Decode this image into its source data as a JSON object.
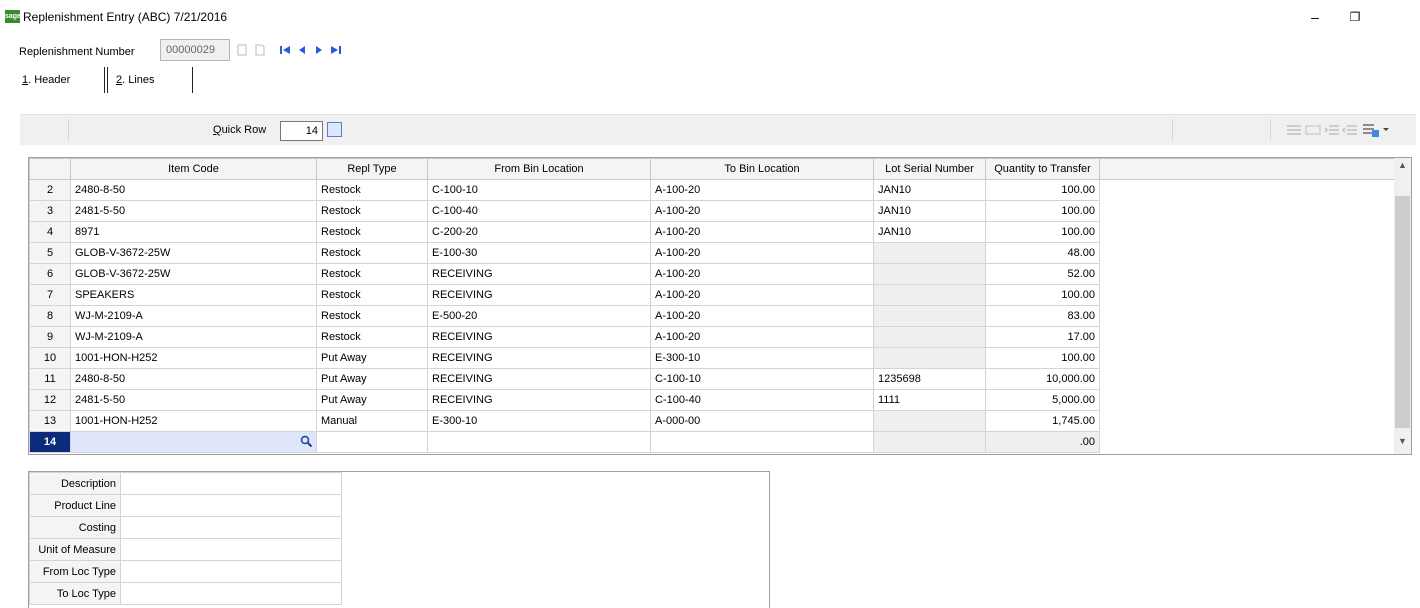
{
  "window": {
    "logo": "sage",
    "title": "Replenishment Entry (ABC) 7/21/2016",
    "minimize": "–",
    "restore": "❐"
  },
  "header": {
    "number_label": "Replenishment Number",
    "number_value": "00000029",
    "nav_icons": [
      "first-record-icon",
      "previous-record-icon",
      "next-record-icon",
      "last-record-icon"
    ]
  },
  "tabs": [
    {
      "key": "1",
      "label": ". Header"
    },
    {
      "key": "2",
      "label": ". Lines"
    }
  ],
  "toolbar": {
    "quick_row_label_key": "Q",
    "quick_row_label_rest": "uick Row",
    "quick_row_value": "14"
  },
  "grid": {
    "columns": [
      "",
      "Item Code",
      "Repl Type",
      "From Bin Location",
      "To Bin Location",
      "Lot Serial Number",
      "Quantity to Transfer"
    ],
    "rows": [
      {
        "n": "2",
        "item": "2480-8-50",
        "type": "Restock",
        "from": "C-100-10",
        "to": "A-100-20",
        "lot": "JAN10",
        "qty": "100.00"
      },
      {
        "n": "3",
        "item": "2481-5-50",
        "type": "Restock",
        "from": "C-100-40",
        "to": "A-100-20",
        "lot": "JAN10",
        "qty": "100.00"
      },
      {
        "n": "4",
        "item": "8971",
        "type": "Restock",
        "from": "C-200-20",
        "to": "A-100-20",
        "lot": "JAN10",
        "qty": "100.00"
      },
      {
        "n": "5",
        "item": "GLOB-V-3672-25W",
        "type": "Restock",
        "from": "E-100-30",
        "to": "A-100-20",
        "lot": "",
        "qty": "48.00"
      },
      {
        "n": "6",
        "item": "GLOB-V-3672-25W",
        "type": "Restock",
        "from": "RECEIVING",
        "to": "A-100-20",
        "lot": "",
        "qty": "52.00"
      },
      {
        "n": "7",
        "item": "SPEAKERS",
        "type": "Restock",
        "from": "RECEIVING",
        "to": "A-100-20",
        "lot": "",
        "qty": "100.00"
      },
      {
        "n": "8",
        "item": "WJ-M-2109-A",
        "type": "Restock",
        "from": "E-500-20",
        "to": "A-100-20",
        "lot": "",
        "qty": "83.00"
      },
      {
        "n": "9",
        "item": "WJ-M-2109-A",
        "type": "Restock",
        "from": "RECEIVING",
        "to": "A-100-20",
        "lot": "",
        "qty": "17.00"
      },
      {
        "n": "10",
        "item": "1001-HON-H252",
        "type": "Put Away",
        "from": "RECEIVING",
        "to": "E-300-10",
        "lot": "",
        "qty": "100.00"
      },
      {
        "n": "11",
        "item": "2480-8-50",
        "type": "Put Away",
        "from": "RECEIVING",
        "to": "C-100-10",
        "lot": "1235698",
        "qty": "10,000.00"
      },
      {
        "n": "12",
        "item": "2481-5-50",
        "type": "Put Away",
        "from": "RECEIVING",
        "to": "C-100-40",
        "lot": "1111",
        "qty": "5,000.00"
      },
      {
        "n": "13",
        "item": "1001-HON-H252",
        "type": "Manual",
        "from": "E-300-10",
        "to": "A-000-00",
        "lot": "",
        "qty": "1,745.00"
      },
      {
        "n": "14",
        "item": "",
        "type": "",
        "from": "",
        "to": "",
        "lot": "",
        "qty": ".00"
      }
    ],
    "gray_lot_rows": [
      3,
      4,
      5,
      6,
      7,
      8,
      11,
      12
    ]
  },
  "detail": {
    "labels": [
      "Description",
      "Product Line",
      "Costing",
      "Unit of Measure",
      "From Loc Type",
      "To Loc Type"
    ]
  }
}
